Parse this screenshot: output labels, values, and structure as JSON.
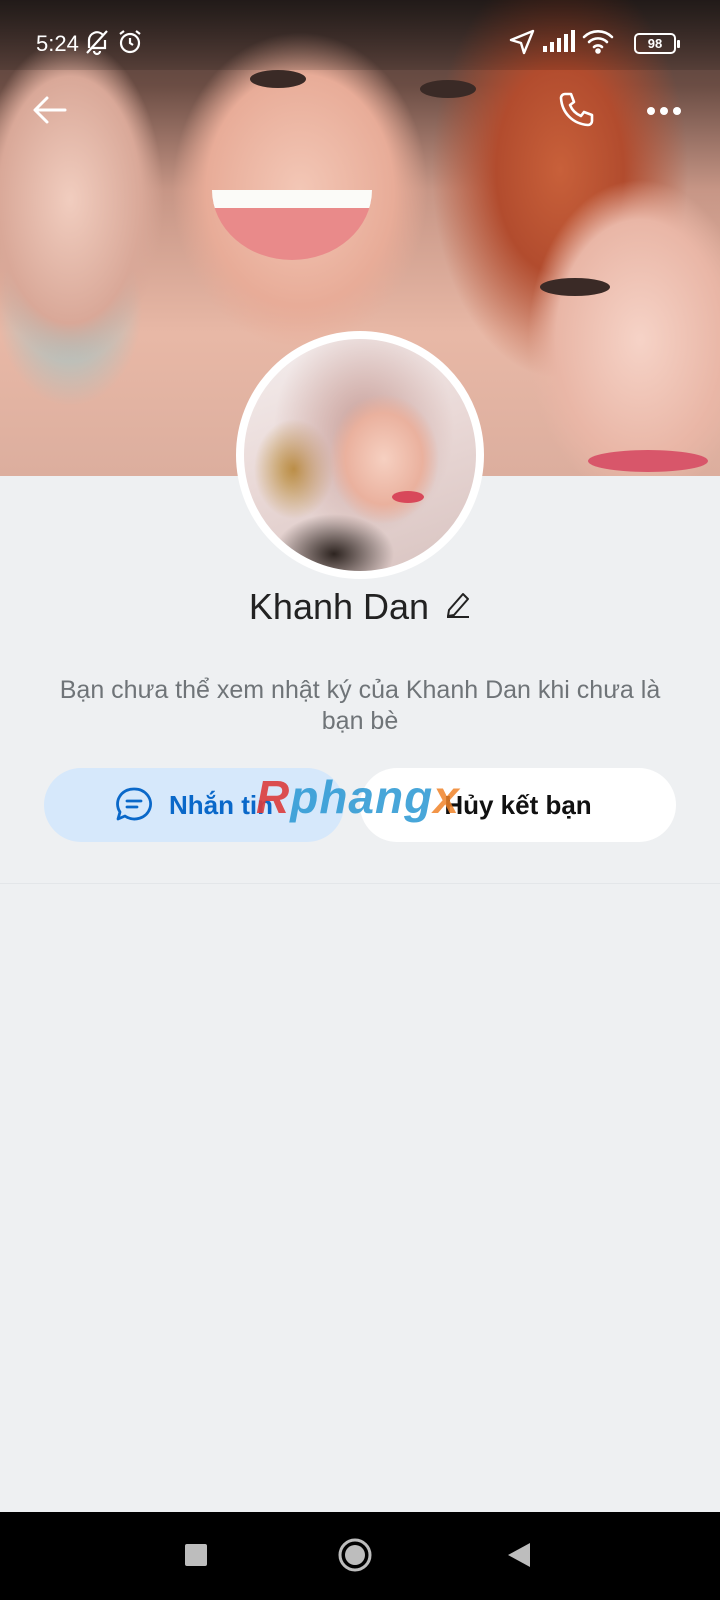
{
  "status_bar": {
    "time": "5:24",
    "battery": "98",
    "icons": [
      "bell-off-icon",
      "alarm-icon",
      "location-arrow-icon",
      "signal-icon",
      "wifi-icon",
      "battery-icon"
    ]
  },
  "header": {
    "back_icon": "arrow-left-icon",
    "call_icon": "phone-icon",
    "more_icon": "more-horizontal-icon"
  },
  "profile": {
    "name": "Khanh Dan",
    "edit_icon": "pencil-icon"
  },
  "privacy_note": "Bạn chưa thể xem nhật ký của Khanh Dan khi chưa là bạn bè",
  "actions": {
    "message_label": "Nhắn tin",
    "message_icon": "chat-bubble-icon",
    "unfriend_label": "Hủy kết bạn"
  },
  "watermark": {
    "r": "R",
    "main": "phang",
    "x": "x"
  },
  "nav_bar": {
    "icons": [
      "square-icon",
      "circle-home-icon",
      "triangle-back-icon"
    ]
  },
  "colors": {
    "accent": "#0a68c9",
    "message_bg": "#d6e8fb",
    "page_bg": "#eef0f2"
  }
}
